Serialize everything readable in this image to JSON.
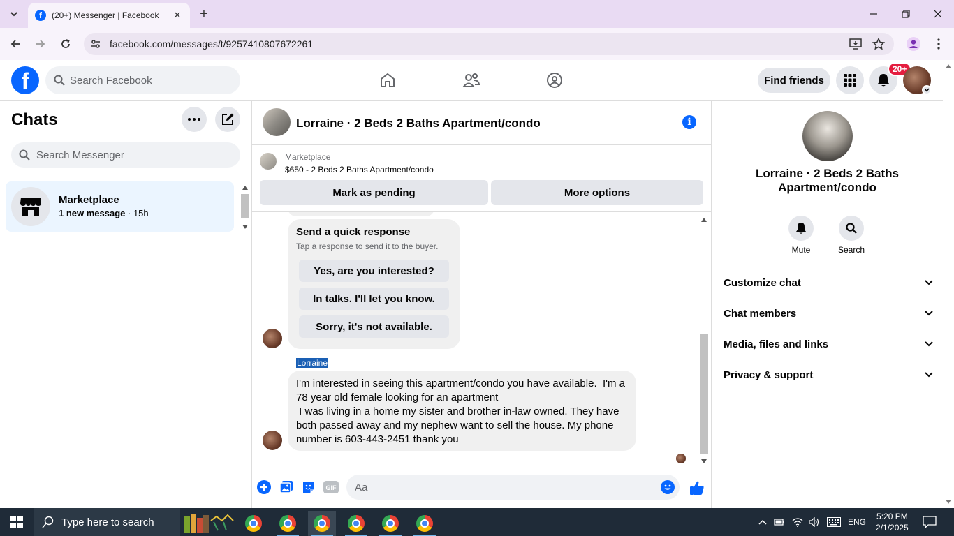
{
  "browser": {
    "tab_title": "(20+) Messenger | Facebook",
    "favicon_letter": "f",
    "url": "facebook.com/messages/t/9257410807672261"
  },
  "fb_header": {
    "search_placeholder": "Search Facebook",
    "find_friends_label": "Find friends",
    "notification_badge": "20+"
  },
  "sidebar": {
    "title": "Chats",
    "search_placeholder": "Search Messenger",
    "chats": [
      {
        "name": "Marketplace",
        "preview": "1 new message",
        "time": "15h"
      }
    ],
    "time_separator": " · "
  },
  "conversation": {
    "title": "Lorraine · 2 Beds 2 Baths Apartment/condo",
    "marketplace_label": "Marketplace",
    "listing": "$650 - 2 Beds 2 Baths Apartment/condo",
    "mark_pending_label": "Mark as pending",
    "more_options_label": "More options",
    "quick_response": {
      "title": "Send a quick response",
      "subtitle": "Tap a response to send it to the buyer.",
      "options": [
        "Yes, are you interested?",
        "In talks. I'll let you know.",
        "Sorry, it's not available."
      ]
    },
    "sender_name": "Lorraine",
    "message": "I'm interested in seeing this apartment/condo you have available.  I'm a 78 year old female looking for an apartment\n I was living in a home my sister and brother in-law owned. They have both passed away and my nephew want to sell the house. My phone number is 603-443-2451 thank you",
    "composer_placeholder": "Aa"
  },
  "right_panel": {
    "name": "Lorraine · 2 Beds 2 Baths Apartment/condo",
    "actions": [
      {
        "label": "Mute",
        "icon": "bell-icon"
      },
      {
        "label": "Search",
        "icon": "search-icon"
      }
    ],
    "sections": [
      "Customize chat",
      "Chat members",
      "Media, files and links",
      "Privacy & support"
    ]
  },
  "taskbar": {
    "search_placeholder": "Type here to search",
    "language": "ENG",
    "time": "5:20 PM",
    "date": "2/1/2025"
  },
  "colors": {
    "facebook_blue": "#0866ff",
    "selected_chat_bg": "#ebf5ff",
    "badge_red": "#e41e3f",
    "taskbar_bg": "#1f2b38",
    "tabstrip_bg": "#e9dbf3"
  }
}
